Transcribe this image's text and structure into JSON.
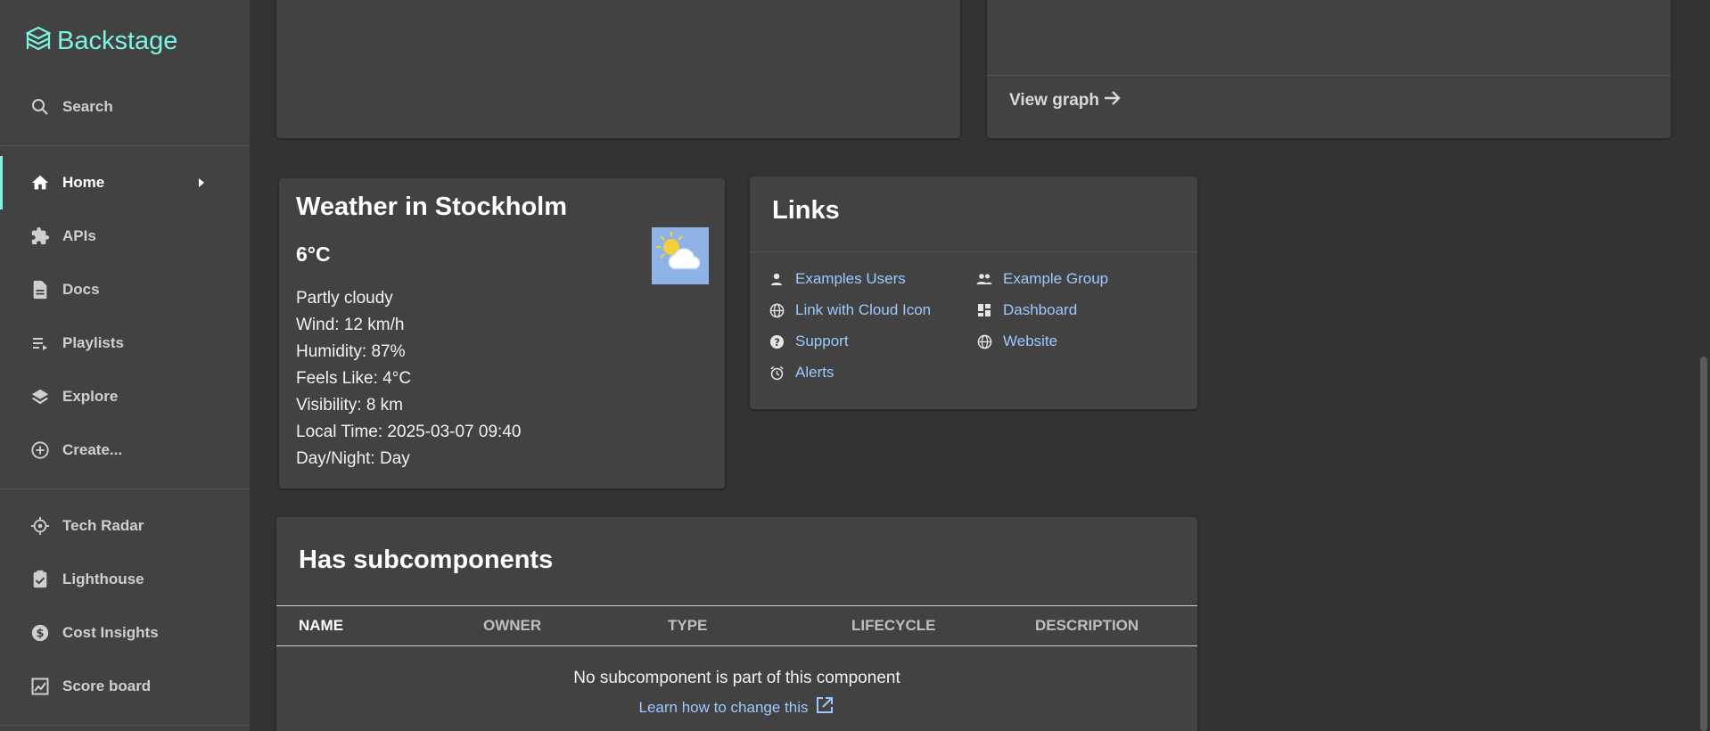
{
  "sidebar": {
    "logo": "Backstage",
    "search": "Search",
    "items": [
      {
        "label": "Home",
        "icon": "home-icon"
      },
      {
        "label": "APIs",
        "icon": "puzzle-icon"
      },
      {
        "label": "Docs",
        "icon": "doc-icon"
      },
      {
        "label": "Playlists",
        "icon": "playlist-icon"
      },
      {
        "label": "Explore",
        "icon": "layers-icon"
      },
      {
        "label": "Create...",
        "icon": "add-circle-icon"
      }
    ],
    "plugins": [
      {
        "label": "Tech Radar",
        "icon": "radar-icon"
      },
      {
        "label": "Lighthouse",
        "icon": "assignment-icon"
      },
      {
        "label": "Cost Insights",
        "icon": "money-icon"
      },
      {
        "label": "Score board",
        "icon": "scoreboard-icon"
      }
    ]
  },
  "top_right_card": {
    "view_graph": "View graph"
  },
  "weather": {
    "title": "Weather in Stockholm",
    "temp": "6°C",
    "condition": "Partly cloudy",
    "wind": "Wind: 12 km/h",
    "humidity": "Humidity: 87%",
    "feels_like": "Feels Like: 4°C",
    "visibility": "Visibility: 8 km",
    "local_time": "Local Time: 2025-03-07 09:40",
    "day_night": "Day/Night: Day"
  },
  "links": {
    "title": "Links",
    "items": [
      {
        "label": "Examples Users",
        "icon": "person-icon"
      },
      {
        "label": "Link with Cloud Icon",
        "icon": "globe-icon"
      },
      {
        "label": "Support",
        "icon": "help-icon"
      },
      {
        "label": "Alerts",
        "icon": "alarm-icon"
      },
      {
        "label": "Example Group",
        "icon": "group-icon"
      },
      {
        "label": "Dashboard",
        "icon": "dashboard-icon"
      },
      {
        "label": "Website",
        "icon": "globe-icon"
      }
    ]
  },
  "subcomponents": {
    "title": "Has subcomponents",
    "columns": [
      "NAME",
      "OWNER",
      "TYPE",
      "LIFECYCLE",
      "DESCRIPTION"
    ],
    "empty_message": "No subcomponent is part of this component",
    "learn_link": "Learn how to change this"
  },
  "colors": {
    "accent": "#7df3e1",
    "link": "#9cc9ff",
    "card": "#424242",
    "background": "#333333"
  }
}
